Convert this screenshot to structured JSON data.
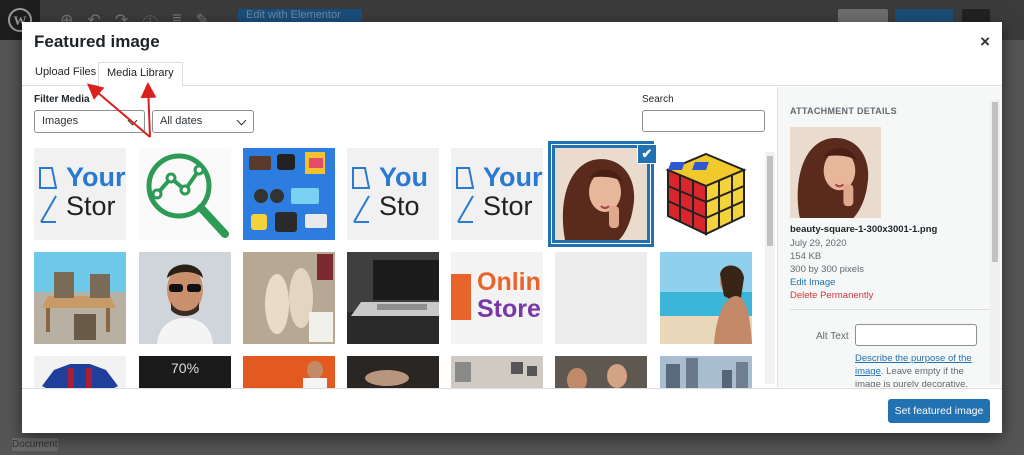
{
  "background": {
    "elementor_button": "Edit with Elementor",
    "status_label": "Document"
  },
  "modal": {
    "title": "Featured image",
    "close_glyph": "×"
  },
  "tabs": [
    {
      "label": "Upload Files"
    },
    {
      "label": "Media Library"
    }
  ],
  "filter": {
    "label": "Filter Media",
    "type_value": "Images",
    "date_value": "All dates",
    "search_label": "Search",
    "search_value": ""
  },
  "grid": {
    "selected_index": 5,
    "thumbnails": [
      {
        "kind": "logo",
        "line1": "Your",
        "line2": "Stor"
      },
      {
        "kind": "analytics-icon"
      },
      {
        "kind": "gadgets"
      },
      {
        "kind": "logo",
        "line1": "You",
        "line2": "Sto"
      },
      {
        "kind": "logo",
        "line1": "Your",
        "line2": "Stor"
      },
      {
        "kind": "portrait"
      },
      {
        "kind": "rubiks-cube"
      },
      {
        "kind": "patio"
      },
      {
        "kind": "man-sunglasses"
      },
      {
        "kind": "slippers"
      },
      {
        "kind": "laptop"
      },
      {
        "kind": "online-store",
        "line1": "Onlin",
        "line2": "Store"
      },
      {
        "kind": "blank"
      },
      {
        "kind": "beach"
      },
      {
        "kind": "jersey"
      },
      {
        "kind": "dark-poster",
        "line1": "70%"
      },
      {
        "kind": "orange-photo"
      },
      {
        "kind": "dark-photo"
      },
      {
        "kind": "room"
      },
      {
        "kind": "people"
      },
      {
        "kind": "city"
      }
    ]
  },
  "details": {
    "heading": "ATTACHMENT DETAILS",
    "filename": "beauty-square-1-300x3001-1.png",
    "date": "July 29, 2020",
    "size": "154 KB",
    "dimensions": "300 by 300 pixels",
    "edit_link": "Edit Image",
    "delete_link": "Delete Permanently",
    "alt_label": "Alt Text",
    "alt_value": "",
    "help_link": "Describe the purpose of the image",
    "help_text": ". Leave empty if the image is purely decorative."
  },
  "footer": {
    "primary_button": "Set featured image"
  },
  "colors": {
    "accent": "#2271b1",
    "danger": "#d63638",
    "annotation": "#d9201c"
  }
}
